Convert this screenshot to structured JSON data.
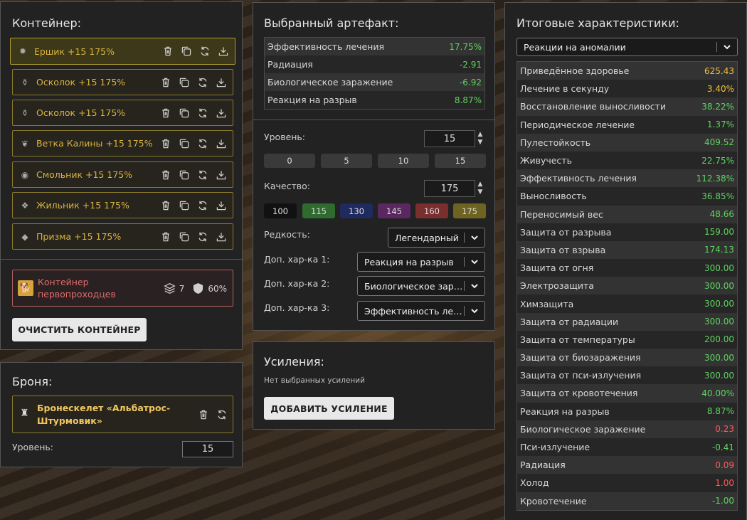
{
  "container": {
    "title": "Контейнер:",
    "items": [
      {
        "label": "Ершик +15 175%",
        "icon": "✹"
      },
      {
        "label": "Осколок +15 175%",
        "icon": "⚱"
      },
      {
        "label": "Осколок +15 175%",
        "icon": "⚱"
      },
      {
        "label": "Ветка Калины +15 175%",
        "icon": "❦"
      },
      {
        "label": "Смольник +15 175%",
        "icon": "◉"
      },
      {
        "label": "Жильник +15 175%",
        "icon": "❖"
      },
      {
        "label": "Призма +15 175%",
        "icon": "◆"
      }
    ],
    "card": {
      "name": "Контейнер первопроходцев",
      "slots": "7",
      "protection": "60%"
    },
    "clear_label": "ОЧИСТИТЬ КОНТЕЙНЕР"
  },
  "armor": {
    "title": "Броня:",
    "name": "Бронескелет «Альбатрос-Штурмовик»",
    "level_label": "Уровень:",
    "level_value": "15"
  },
  "artifact": {
    "title": "Выбранный артефакт:",
    "stats": [
      {
        "name": "Эффективность лечения",
        "value": "17.75%",
        "tone": "pos"
      },
      {
        "name": "Радиация",
        "value": "-2.91",
        "tone": "pos"
      },
      {
        "name": "Биологическое заражение",
        "value": "-6.92",
        "tone": "pos"
      },
      {
        "name": "Реакция на разрыв",
        "value": "8.87%",
        "tone": "pos"
      }
    ],
    "level_label": "Уровень:",
    "level_value": "15",
    "level_presets": [
      "0",
      "5",
      "10",
      "15"
    ],
    "quality_label": "Качество:",
    "quality_value": "175",
    "quality_presets": [
      {
        "label": "100",
        "color": "#111111"
      },
      {
        "label": "115",
        "color": "#2f6b2f"
      },
      {
        "label": "130",
        "color": "#1f2a5e"
      },
      {
        "label": "145",
        "color": "#5b2760"
      },
      {
        "label": "160",
        "color": "#7a2f2f"
      },
      {
        "label": "175",
        "color": "#6e6320"
      }
    ],
    "rarity_label": "Редкость:",
    "rarity_value": "Легендарный",
    "extra1_label": "Доп. хар-ка 1:",
    "extra1_value": "Реакция на разрыв",
    "extra2_label": "Доп. хар-ка 2:",
    "extra2_value": "Биологическое заражение",
    "extra3_label": "Доп. хар-ка 3:",
    "extra3_value": "Эффективность лечения"
  },
  "boosts": {
    "title": "Усиления:",
    "empty_text": "Нет выбранных усилений",
    "add_label": "ДОБАВИТЬ УСИЛЕНИЕ"
  },
  "totals": {
    "title": "Итоговые характеристики:",
    "filter_value": "Реакции на аномалии",
    "stats": [
      {
        "name": "Приведённое здоровье",
        "value": "625.43",
        "tone": "gold"
      },
      {
        "name": "Лечение в секунду",
        "value": "3.40%",
        "tone": "gold"
      },
      {
        "name": "Восстановление выносливости",
        "value": "38.22%",
        "tone": "pos"
      },
      {
        "name": "Периодическое лечение",
        "value": "1.37%",
        "tone": "pos"
      },
      {
        "name": "Пулестойкость",
        "value": "409.52",
        "tone": "pos"
      },
      {
        "name": "Живучесть",
        "value": "22.75%",
        "tone": "pos"
      },
      {
        "name": "Эффективность лечения",
        "value": "112.38%",
        "tone": "pos"
      },
      {
        "name": "Выносливость",
        "value": "36.85%",
        "tone": "pos"
      },
      {
        "name": "Переносимый вес",
        "value": "48.66",
        "tone": "pos"
      },
      {
        "name": "Защита от разрыва",
        "value": "159.00",
        "tone": "pos"
      },
      {
        "name": "Защита от взрыва",
        "value": "174.13",
        "tone": "pos"
      },
      {
        "name": "Защита от огня",
        "value": "300.00",
        "tone": "pos"
      },
      {
        "name": "Электрозащита",
        "value": "300.00",
        "tone": "pos"
      },
      {
        "name": "Химзащита",
        "value": "300.00",
        "tone": "pos"
      },
      {
        "name": "Защита от радиации",
        "value": "300.00",
        "tone": "pos"
      },
      {
        "name": "Защита от температуры",
        "value": "200.00",
        "tone": "pos"
      },
      {
        "name": "Защита от биозаражения",
        "value": "300.00",
        "tone": "pos"
      },
      {
        "name": "Защита от пси-излучения",
        "value": "300.00",
        "tone": "pos"
      },
      {
        "name": "Защита от кровотечения",
        "value": "40.00%",
        "tone": "pos"
      },
      {
        "name": "Реакция на разрыв",
        "value": "8.87%",
        "tone": "pos"
      },
      {
        "name": "Биологическое заражение",
        "value": "0.23",
        "tone": "neg"
      },
      {
        "name": "Пси-излучение",
        "value": "-0.41",
        "tone": "pos"
      },
      {
        "name": "Радиация",
        "value": "0.09",
        "tone": "neg"
      },
      {
        "name": "Холод",
        "value": "1.00",
        "tone": "neg"
      },
      {
        "name": "Кровотечение",
        "value": "-1.00",
        "tone": "pos"
      }
    ]
  }
}
